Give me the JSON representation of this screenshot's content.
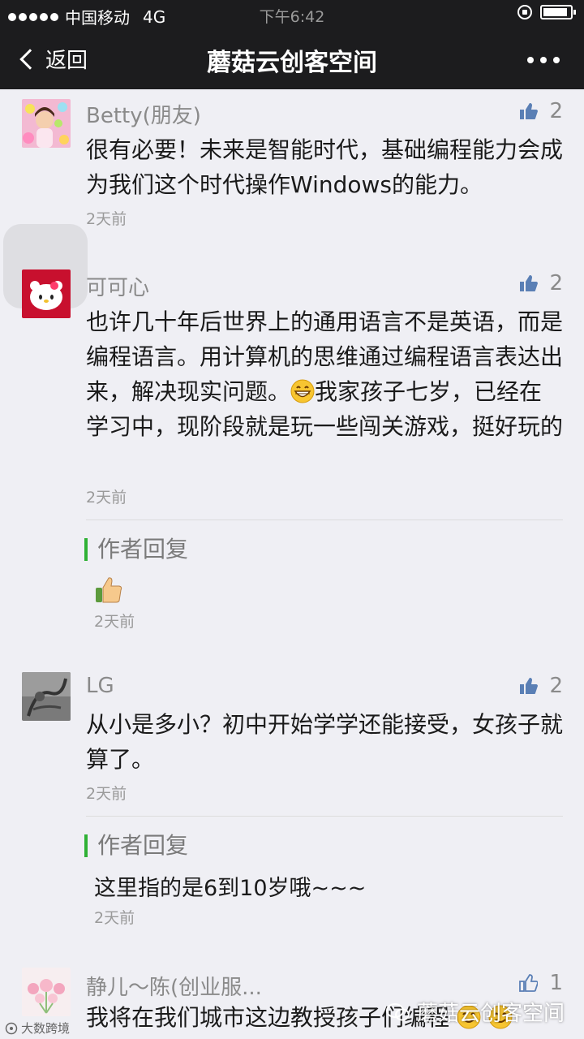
{
  "status_bar": {
    "carrier": "中国移动",
    "network": "4G",
    "time": "下午6:42",
    "battery_level": 0.9
  },
  "nav": {
    "back_label": "返回",
    "title": "蘑菇云创客空间"
  },
  "comments": [
    {
      "name": "Betty(朋友)",
      "likes": "2",
      "text": "很有必要！未来是智能时代，基础编程能力会成为我们这个时代操作Windows的能力。",
      "time": "2天前"
    },
    {
      "name": "可可心",
      "likes": "2",
      "text_1": "也许几十年后世界上的通用语言不是英语，而是编程语言。用计算机的思维通过编程语言表达出来，解决现实问题。",
      "text_2": "我家孩子七岁，已经在学习中，现阶段就是玩一些闯关游戏，挺好玩的",
      "time": "2天前",
      "reply": {
        "label": "作者回复",
        "emoji": "thumbs-up",
        "time": "2天前"
      }
    },
    {
      "name": "LG",
      "likes": "2",
      "text": "从小是多小？初中开始学学还能接受，女孩子就算了。",
      "time": "2天前",
      "reply": {
        "label": "作者回复",
        "text": "这里指的是6到10岁哦~~~",
        "time": "2天前"
      }
    },
    {
      "name": "静儿～陈(创业服...",
      "likes": "1",
      "text": "我将在我们城市这边教授孩子们编程"
    }
  ],
  "watermark": {
    "text": "蘑菇云创客空间"
  },
  "source_watermark": "大数跨境",
  "colors": {
    "nav_background": "#1c1c1e",
    "page_background": "#efeff4",
    "reply_accent": "#2fb135",
    "like_icon": "#5a7fb5"
  },
  "icons": [
    "back-chevron-icon",
    "more-icon",
    "thumbs-up-icon",
    "grin-emoji-icon",
    "smile-emoji-icon"
  ]
}
